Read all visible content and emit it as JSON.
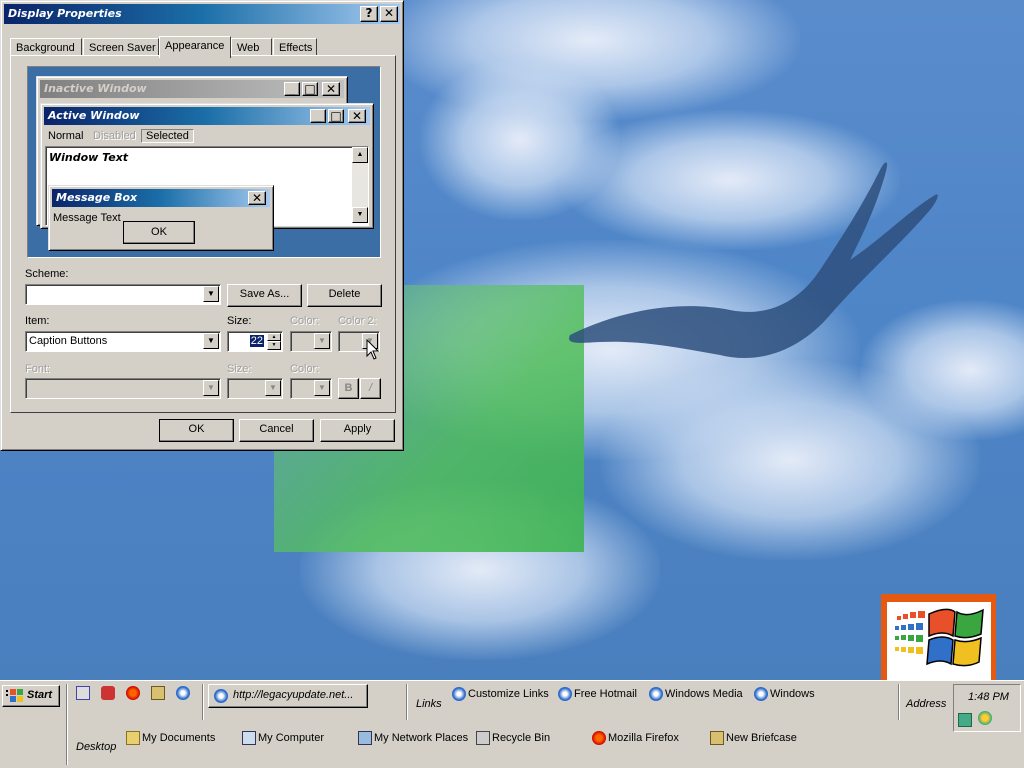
{
  "dialog": {
    "title": "Display Properties",
    "help_btn": "?",
    "close_btn": "✕",
    "tabs": [
      "Background",
      "Screen Saver",
      "Appearance",
      "Web",
      "Effects"
    ],
    "active_tab": "Appearance",
    "preview": {
      "inactive_title": "Inactive Window",
      "active_title": "Active Window",
      "menu": [
        "Normal",
        "Disabled",
        "Selected"
      ],
      "window_text": "Window Text",
      "msgbox_title": "Message Box",
      "msgbox_text": "Message Text",
      "msgbox_ok": "OK"
    },
    "scheme_label": "Scheme:",
    "scheme_value": "",
    "save_as": "Save As...",
    "delete": "Delete",
    "item_label": "Item:",
    "item_value": "Caption Buttons",
    "size_label": "Size:",
    "size_value": "22",
    "color_label": "Color:",
    "color2_label": "Color 2:",
    "font_label": "Font:",
    "font_size_label": "Size:",
    "font_color_label": "Color:",
    "bold": "B",
    "italic": "/",
    "ok": "OK",
    "cancel": "Cancel",
    "apply": "Apply"
  },
  "taskbar": {
    "start": "Start",
    "address_bar_item": "http://legacyupdate.net...",
    "links_label": "Links",
    "links": [
      "Customize Links",
      "Free Hotmail",
      "Windows Media",
      "Windows"
    ],
    "address_label": "Address",
    "clock": "1:48 PM",
    "desktop_label": "Desktop",
    "desktop_items": [
      "My Documents",
      "My Computer",
      "My Network Places",
      "Recycle Bin",
      "Mozilla Firefox",
      "New Briefcase"
    ]
  },
  "colors": {
    "titlebar_active_start": "#0a246a",
    "titlebar_active_end": "#a6caf0",
    "titlebar_inactive": "#808080",
    "desktop": "#4f86c8",
    "face": "#d4d0c8"
  }
}
